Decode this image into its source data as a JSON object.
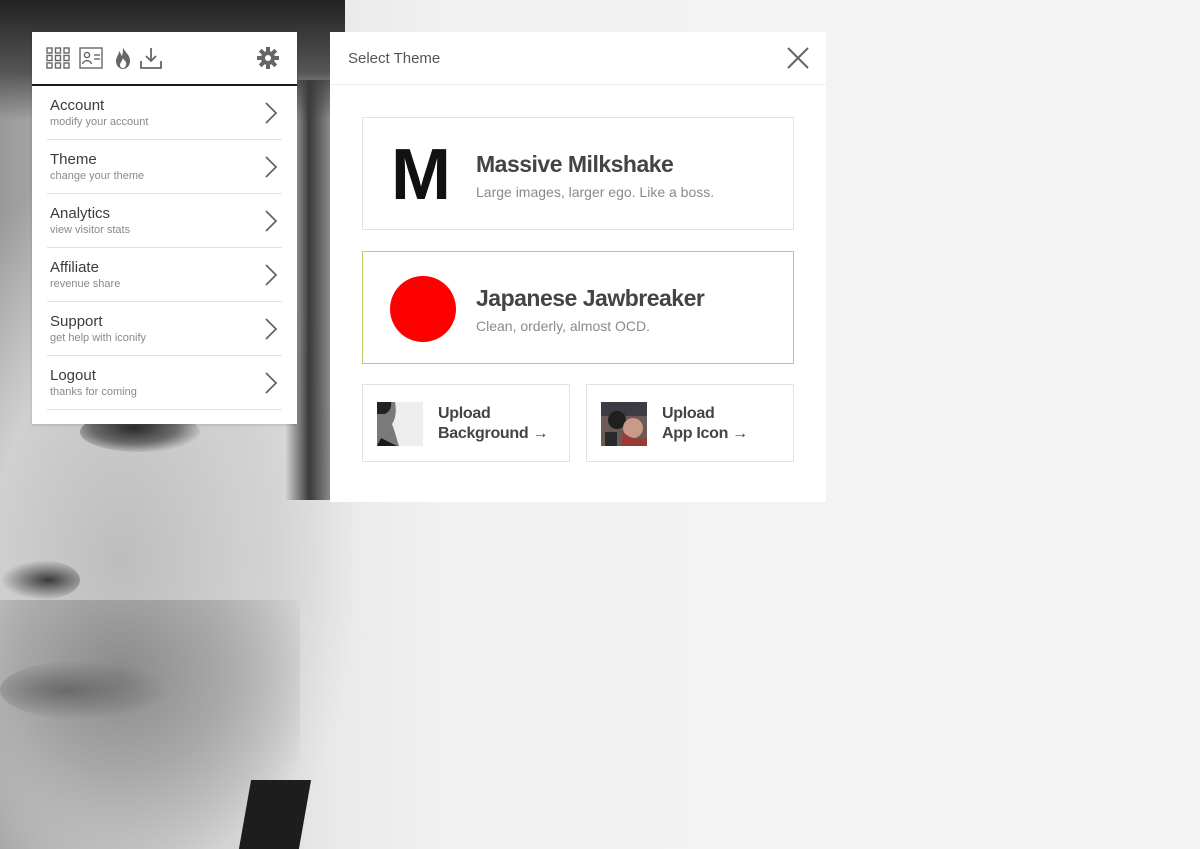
{
  "toolbar": {
    "icons": [
      "grid-icon",
      "profile-card-icon",
      "flame-icon",
      "download-icon",
      "gear-icon"
    ]
  },
  "menu": {
    "items": [
      {
        "title": "Account",
        "subtitle": "modify your account"
      },
      {
        "title": "Theme",
        "subtitle": "change your theme"
      },
      {
        "title": "Analytics",
        "subtitle": "view visitor stats"
      },
      {
        "title": "Affiliate",
        "subtitle": "revenue share"
      },
      {
        "title": "Support",
        "subtitle": "get help with iconify"
      },
      {
        "title": "Logout",
        "subtitle": "thanks for coming"
      }
    ]
  },
  "dialog": {
    "title": "Select Theme",
    "themes": [
      {
        "logo": "M",
        "name": "Massive Milkshake",
        "description": "Large images, larger ego. Like a boss.",
        "selected": false
      },
      {
        "logo": "",
        "name": "Japanese Jawbreaker",
        "description": "Clean, orderly, almost OCD.",
        "selected": true
      }
    ],
    "uploads": [
      {
        "line1": "Upload",
        "line2": "Background →"
      },
      {
        "line1": "Upload",
        "line2": "App Icon →"
      }
    ]
  },
  "colors": {
    "selected_border": "#b4cf6a",
    "jawbreaker_red": "#ff0000",
    "text_dark": "#444444",
    "text_muted": "#8a8a8a"
  }
}
